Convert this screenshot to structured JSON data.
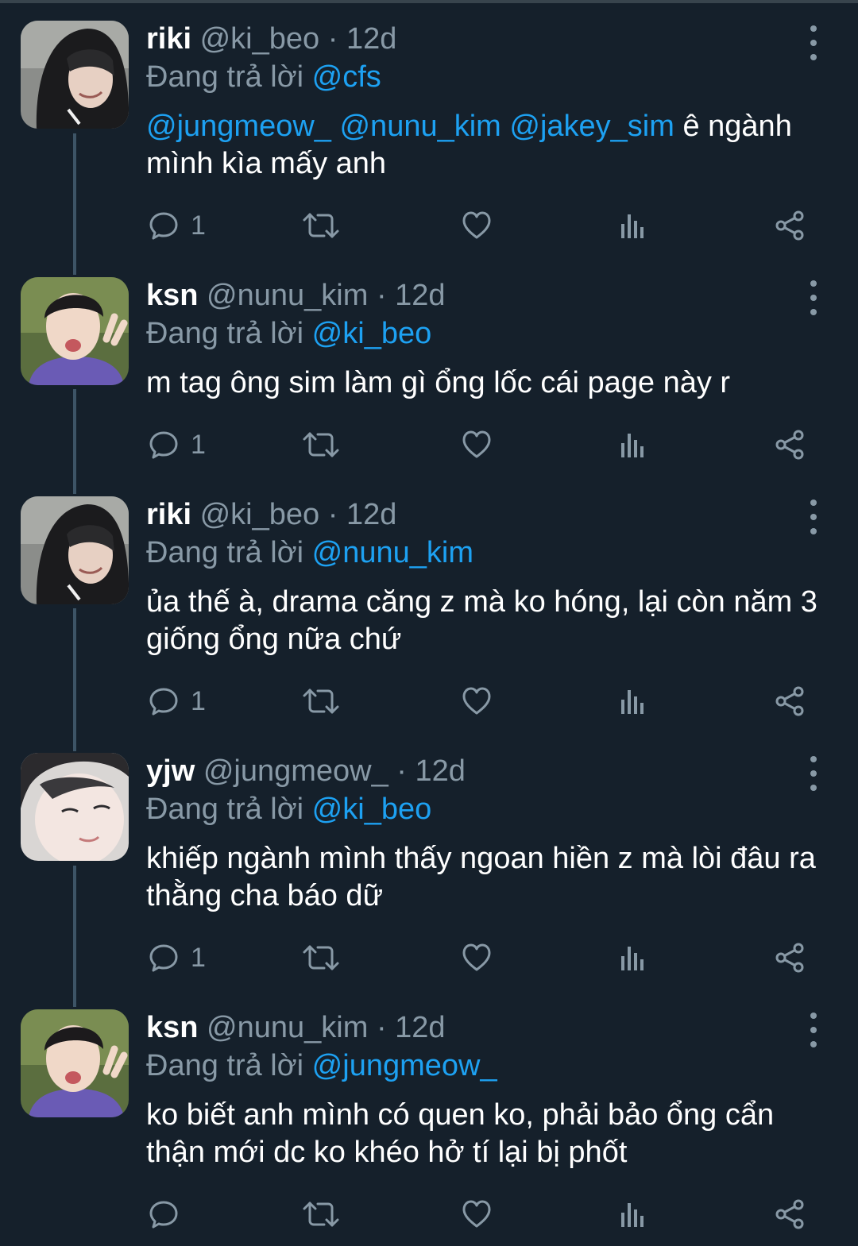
{
  "tweets": [
    {
      "name": "riki",
      "handle": "@ki_beo",
      "time": "· 12d",
      "reply_prefix": "Đang trả lời",
      "reply_to": "@cfs",
      "mentions": [
        "@jungmeow_",
        "@nunu_kim",
        "@jakey_sim"
      ],
      "text": "ê ngành mình kìa mấy anh",
      "reply_count": "1"
    },
    {
      "name": "ksn",
      "handle": "@nunu_kim",
      "time": "· 12d",
      "reply_prefix": "Đang trả lời",
      "reply_to": "@ki_beo",
      "text": "m tag ông sim làm gì ổng lốc cái page này r",
      "reply_count": "1"
    },
    {
      "name": "riki",
      "handle": "@ki_beo",
      "time": "· 12d",
      "reply_prefix": "Đang trả lời",
      "reply_to": "@nunu_kim",
      "text": "ủa thế à, drama căng z mà ko hóng, lại còn năm 3 giống ổng nữa chứ",
      "reply_count": "1"
    },
    {
      "name": "yjw",
      "handle": "@jungmeow_",
      "time": "· 12d",
      "reply_prefix": "Đang trả lời",
      "reply_to": "@ki_beo",
      "text": "khiếp ngành mình thấy ngoan hiền z mà lòi đâu ra thằng cha báo dữ",
      "reply_count": "1"
    },
    {
      "name": "ksn",
      "handle": "@nunu_kim",
      "time": "· 12d",
      "reply_prefix": "Đang trả lời",
      "reply_to": "@jungmeow_",
      "text": "ko biết anh mình có quen ko, phải bảo ổng cẩn thận mới dc ko khéo hở tí lại bị phốt",
      "reply_count": ""
    }
  ],
  "icons": {
    "reply": "speech-bubble-icon",
    "retweet": "retweet-arrows-icon",
    "like": "heart-icon",
    "analytics": "bar-chart-icon",
    "share": "share-nodes-icon",
    "more": "vertical-dots-icon"
  },
  "colors": {
    "background": "#15202b",
    "mention": "#1da1f2",
    "secondary_text": "#8899a6",
    "thread_line": "#3d5466"
  }
}
